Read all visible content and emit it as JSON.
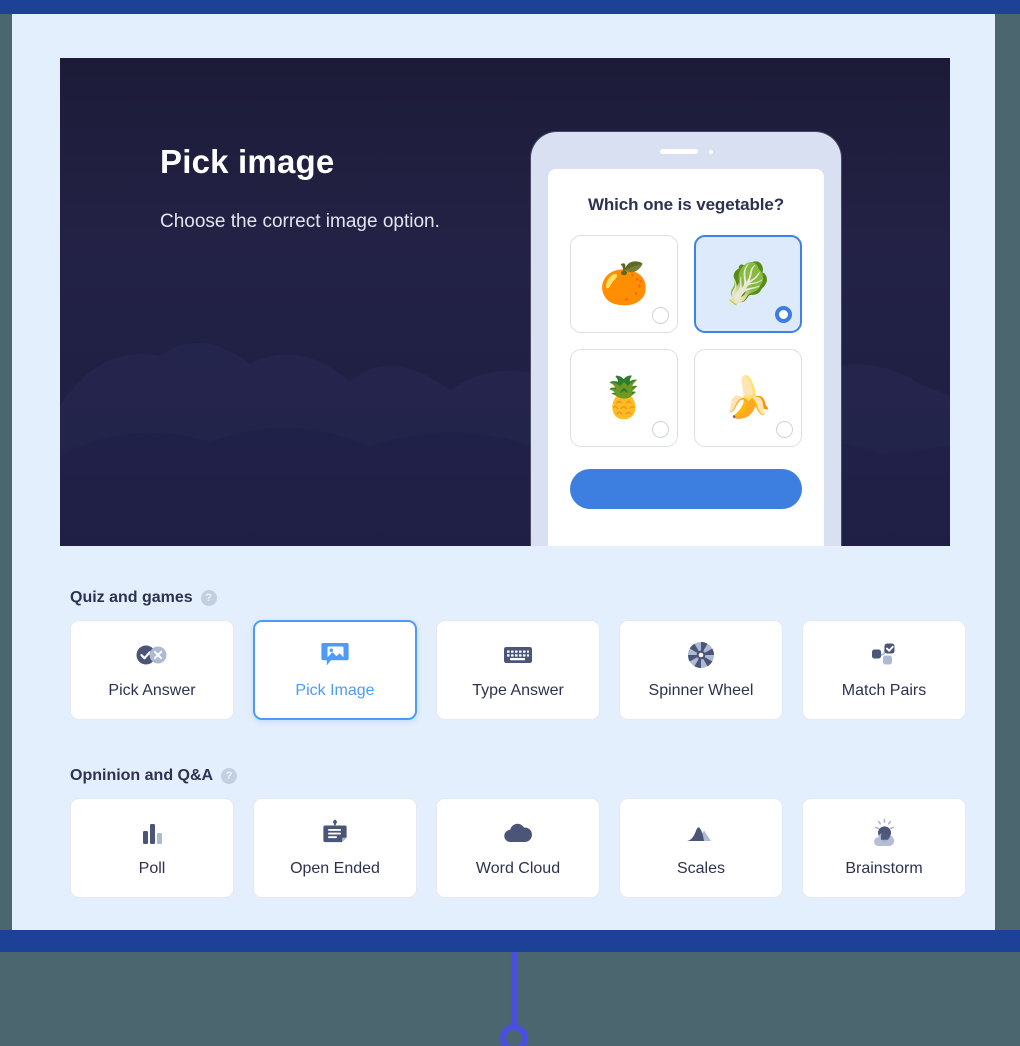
{
  "theme": {
    "band_blue": "#1d4197",
    "panel_bg": "#e3effc",
    "page_bg": "#4c6670",
    "accent_blue": "#4d9bf6",
    "ink": "#2d3250",
    "icon_dark": "#4a5578",
    "icon_light": "#aebad4"
  },
  "hero": {
    "title": "Pick image",
    "subtitle": "Choose the correct image option.",
    "phone": {
      "question": "Which one is vegetable?",
      "options": [
        {
          "name": "orange",
          "emoji": "🍊",
          "selected": false
        },
        {
          "name": "cabbage",
          "emoji": "🥬",
          "selected": true
        },
        {
          "name": "pineapple",
          "emoji": "🍍",
          "selected": false
        },
        {
          "name": "banana",
          "emoji": "🍌",
          "selected": false
        }
      ],
      "submit_label": ""
    }
  },
  "sections": [
    {
      "title": "Quiz and games",
      "help": "?",
      "cards": [
        {
          "label": "Pick Answer",
          "icon": "check-cross-icon",
          "selected": false
        },
        {
          "label": "Pick Image",
          "icon": "image-bubble-icon",
          "selected": true
        },
        {
          "label": "Type Answer",
          "icon": "keyboard-icon",
          "selected": false
        },
        {
          "label": "Spinner Wheel",
          "icon": "spinner-wheel-icon",
          "selected": false
        },
        {
          "label": "Match Pairs",
          "icon": "match-pairs-icon",
          "selected": false
        }
      ]
    },
    {
      "title": "Opninion and Q&A",
      "help": "?",
      "cards": [
        {
          "label": "Poll",
          "icon": "bar-chart-icon",
          "selected": false
        },
        {
          "label": "Open Ended",
          "icon": "note-icon",
          "selected": false
        },
        {
          "label": "Word Cloud",
          "icon": "cloud-icon",
          "selected": false
        },
        {
          "label": "Scales",
          "icon": "mountains-icon",
          "selected": false
        },
        {
          "label": "Brainstorm",
          "icon": "lightbulb-cloud-icon",
          "selected": false
        }
      ]
    }
  ]
}
